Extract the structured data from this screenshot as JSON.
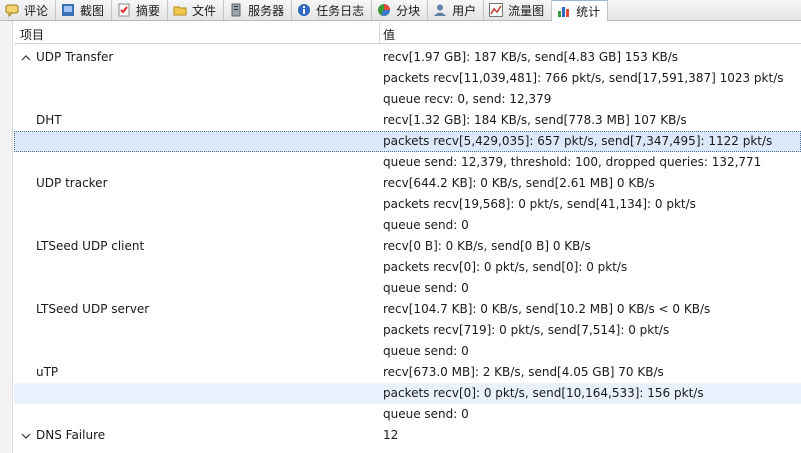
{
  "tabs": [
    {
      "label": "评论",
      "icon": "comment-icon",
      "active": false
    },
    {
      "label": "截图",
      "icon": "screenshot-icon",
      "active": false
    },
    {
      "label": "摘要",
      "icon": "summary-icon",
      "active": false
    },
    {
      "label": "文件",
      "icon": "file-icon",
      "active": false
    },
    {
      "label": "服务器",
      "icon": "server-icon",
      "active": false
    },
    {
      "label": "任务日志",
      "icon": "info-icon",
      "active": false
    },
    {
      "label": "分块",
      "icon": "pie-chart-icon",
      "active": false
    },
    {
      "label": "用户",
      "icon": "user-icon",
      "active": false
    },
    {
      "label": "流量图",
      "icon": "line-chart-icon",
      "active": false
    },
    {
      "label": "统计",
      "icon": "stats-icon",
      "active": true
    }
  ],
  "columns": {
    "item": "项目",
    "value": "值"
  },
  "rows": [
    {
      "name": "UDP Transfer",
      "toggle": "^",
      "value": "recv[1.97 GB]: 187 KB/s, send[4.83 GB] 153 KB/s"
    },
    {
      "name": "",
      "value": "packets recv[11,039,481]: 766 pkt/s, send[17,591,387] 1023 pkt/s"
    },
    {
      "name": "",
      "value": "queue recv: 0, send: 12,379"
    },
    {
      "name": "DHT",
      "value": "recv[1.32 GB]: 184 KB/s, send[778.3 MB] 107 KB/s"
    },
    {
      "name": "",
      "value": "packets recv[5,429,035]: 657 pkt/s, send[7,347,495]: 1122 pkt/s",
      "state": "sel"
    },
    {
      "name": "",
      "value": "queue send: 12,379, threshold: 100, dropped queries: 132,771"
    },
    {
      "name": "UDP tracker",
      "value": "recv[644.2 KB]: 0 KB/s, send[2.61 MB] 0 KB/s"
    },
    {
      "name": "",
      "value": "packets recv[19,568]: 0 pkt/s, send[41,134]: 0 pkt/s"
    },
    {
      "name": "",
      "value": "queue send: 0"
    },
    {
      "name": "LTSeed UDP client",
      "value": "recv[0 B]: 0 KB/s, send[0 B] 0 KB/s"
    },
    {
      "name": "",
      "value": "packets recv[0]: 0 pkt/s, send[0]: 0 pkt/s"
    },
    {
      "name": "",
      "value": "queue send: 0"
    },
    {
      "name": "LTSeed UDP server",
      "value": "recv[104.7 KB]: 0 KB/s, send[10.2 MB] 0 KB/s < 0 KB/s"
    },
    {
      "name": "",
      "value": "packets recv[719]: 0 pkt/s, send[7,514]: 0 pkt/s"
    },
    {
      "name": "",
      "value": "queue send: 0"
    },
    {
      "name": "uTP",
      "value": "recv[673.0 MB]: 2 KB/s, send[4.05 GB] 70 KB/s"
    },
    {
      "name": "",
      "value": "packets recv[0]: 0 pkt/s, send[10,164,533]: 156 pkt/s",
      "state": "hl"
    },
    {
      "name": "",
      "value": "queue send: 0"
    },
    {
      "name": "DNS Failure",
      "toggle": "v",
      "value": "12"
    }
  ]
}
